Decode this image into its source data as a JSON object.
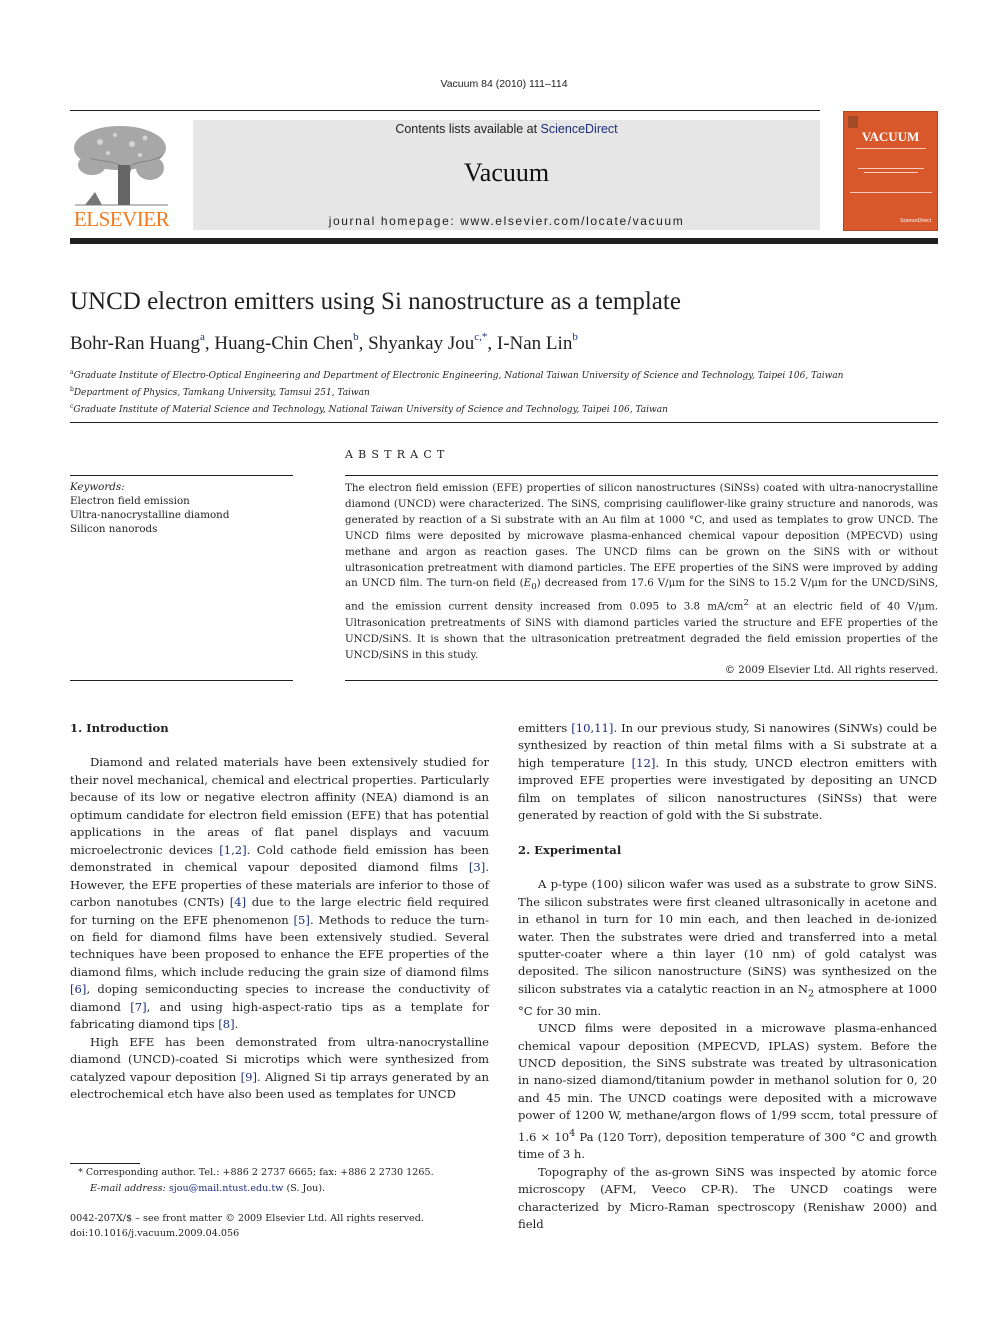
{
  "running_head": "Vacuum 84 (2010) 111–114",
  "masthead": {
    "contents_prefix": "Contents lists available at ",
    "contents_link": "ScienceDirect",
    "journal_title": "Vacuum",
    "homepage": "journal homepage: www.elsevier.com/locate/vacuum",
    "publisher_logo_text": "ELSEVIER",
    "cover_title": "VACUUM",
    "colors": {
      "publisher_orange": "#f07b1f",
      "cover_orange": "#d9582b",
      "link_blue": "#1c2e7a",
      "masthead_gray": "#e6e6e6"
    }
  },
  "article": {
    "title": "UNCD electron emitters using Si nanostructure as a template",
    "authors": [
      {
        "name": "Bohr-Ran Huang",
        "sup": "a",
        "sep": ", "
      },
      {
        "name": "Huang-Chin Chen",
        "sup": "b",
        "sep": ", "
      },
      {
        "name": "Shyankay Jou",
        "sup": "c,*",
        "sep": ", "
      },
      {
        "name": "I-Nan Lin",
        "sup": "b",
        "sep": ""
      }
    ],
    "affiliations": [
      {
        "sup": "a",
        "text": "Graduate Institute of Electro-Optical Engineering and Department of Electronic Engineering, National Taiwan University of Science and Technology, Taipei 106, Taiwan"
      },
      {
        "sup": "b",
        "text": "Department of Physics, Tamkang University, Tamsui 251, Taiwan"
      },
      {
        "sup": "c",
        "text": "Graduate Institute of Material Science and Technology, National Taiwan University of Science and Technology, Taipei 106, Taiwan"
      }
    ]
  },
  "keywords": {
    "label": "Keywords:",
    "items": [
      "Electron field emission",
      "Ultra-nanocrystalline diamond",
      "Silicon nanorods"
    ]
  },
  "abstract": {
    "heading": "ABSTRACT",
    "p1": "The electron field emission (EFE) properties of silicon nanostructures (SiNSs) coated with ultra-nanocrystalline diamond (UNCD) were characterized. The SiNS, comprising cauliflower-like grainy structure and nanorods, was generated by reaction of a Si substrate with an Au film at 1000 °C, and used as templates to grow UNCD. The UNCD films were deposited by microwave plasma-enhanced chemical vapour deposition (MPECVD) using methane and argon as reaction gases. The UNCD films can be grown on the SiNS with or without ultrasonication pretreatment with diamond particles. The EFE properties of the SiNS were improved by adding an UNCD film. The turn-on field (",
    "e0_main": "E",
    "e0_sub": "0",
    "p2": ") decreased from 17.6 V/μm for the SiNS to 15.2 V/μm for the UNCD/SiNS, and the emission current density increased from 0.095 to 3.8 mA/cm",
    "p2_sup": "2",
    "p3": " at an electric field of 40 V/μm. Ultrasonication pretreatments of SiNS with diamond particles varied the structure and EFE properties of the UNCD/SiNS. It is shown that the ultrasonication pretreatment degraded the field emission properties of the UNCD/SiNS in this study.",
    "copyright": "© 2009 Elsevier Ltd. All rights reserved."
  },
  "intro": {
    "heading": "1.  Introduction",
    "p1": [
      {
        "t": "Diamond and related materials have been extensively studied for their novel mechanical, chemical and electrical properties. Particularly because of its low or negative electron affinity (NEA) diamond is an optimum candidate for electron field emission (EFE) that has potential applications in the areas of flat panel displays and vacuum microelectronic devices "
      },
      {
        "c": "[1,2]"
      },
      {
        "t": ". Cold cathode field emission has been demonstrated in chemical vapour deposited diamond films "
      },
      {
        "c": "[3]"
      },
      {
        "t": ". However, the EFE properties of these materials are inferior to those of carbon nanotubes (CNTs) "
      },
      {
        "c": "[4]"
      },
      {
        "t": " due to the large electric field required for turning on the EFE phenomenon "
      },
      {
        "c": "[5]"
      },
      {
        "t": ". Methods to reduce the turn-on field for diamond films have been extensively studied. Several techniques have been proposed to enhance the EFE properties of the diamond films, which include reducing the grain size of diamond films "
      },
      {
        "c": "[6]"
      },
      {
        "t": ", doping semiconducting species to increase the conductivity of diamond "
      },
      {
        "c": "[7]"
      },
      {
        "t": ", and using high-aspect-ratio tips as a template for fabricating diamond tips "
      },
      {
        "c": "[8]"
      },
      {
        "t": "."
      }
    ],
    "p2": [
      {
        "t": "High EFE has been demonstrated from ultra-nanocrystalline diamond (UNCD)-coated Si microtips which were synthesized from catalyzed vapour deposition "
      },
      {
        "c": "[9]"
      },
      {
        "t": ". Aligned Si tip arrays generated by an electrochemical etch have also been used as templates for UNCD emitters "
      },
      {
        "c": "[10,11]"
      },
      {
        "t": ". In our previous study, Si nanowires (SiNWs) could be synthesized by reaction of thin metal films with a Si substrate at a high temperature "
      },
      {
        "c": "[12]"
      },
      {
        "t": ". In this study, UNCD electron emitters with improved EFE properties were investigated by depositing an UNCD film on templates of silicon nanostructures (SiNSs) that were generated by reaction of gold with the Si substrate."
      }
    ]
  },
  "experimental": {
    "heading": "2.  Experimental",
    "p1a": "A p-type (100) silicon wafer was used as a substrate to grow SiNS. The silicon substrates were first cleaned ultrasonically in acetone and in ethanol in turn for 10 min each, and then leached in de-ionized water. Then the substrates were dried and transferred into a metal sputter-coater where a thin layer (10 nm) of gold catalyst was deposited. The silicon nanostructure (SiNS) was synthesized on the silicon substrates via a catalytic reaction in an N",
    "p1_sub": "2",
    "p1b": " atmosphere at 1000 °C for 30 min.",
    "p2a": "UNCD films were deposited in a microwave plasma-enhanced chemical vapour deposition (MPECVD, IPLAS) system. Before the UNCD deposition, the SiNS substrate was treated by ultrasonication in nano-sized diamond/titanium powder in methanol solution for 0, 20 and 45 min. The UNCD coatings were deposited with a microwave power of 1200 W, methane/argon flows of 1/99 sccm, total pressure of 1.6 × 10",
    "p2_sup": "4",
    "p2b": " Pa (120 Torr), deposition temperature of 300 °C and growth time of 3 h.",
    "p3": "Topography of the as-grown SiNS was inspected by atomic force microscopy (AFM, Veeco CP-R). The UNCD coatings were characterized by Micro-Raman spectroscopy (Renishaw 2000) and field"
  },
  "footnote": {
    "corresponding": "*  Corresponding author. Tel.: +886 2 2737 6665; fax: +886 2 2730 1265.",
    "email_label": "E-mail address: ",
    "email": "sjou@mail.ntust.edu.tw",
    "email_suffix": " (S. Jou)."
  },
  "front_matter": {
    "issn_line": "0042-207X/$ – see front matter © 2009 Elsevier Ltd. All rights reserved.",
    "doi": "doi:10.1016/j.vacuum.2009.04.056"
  }
}
